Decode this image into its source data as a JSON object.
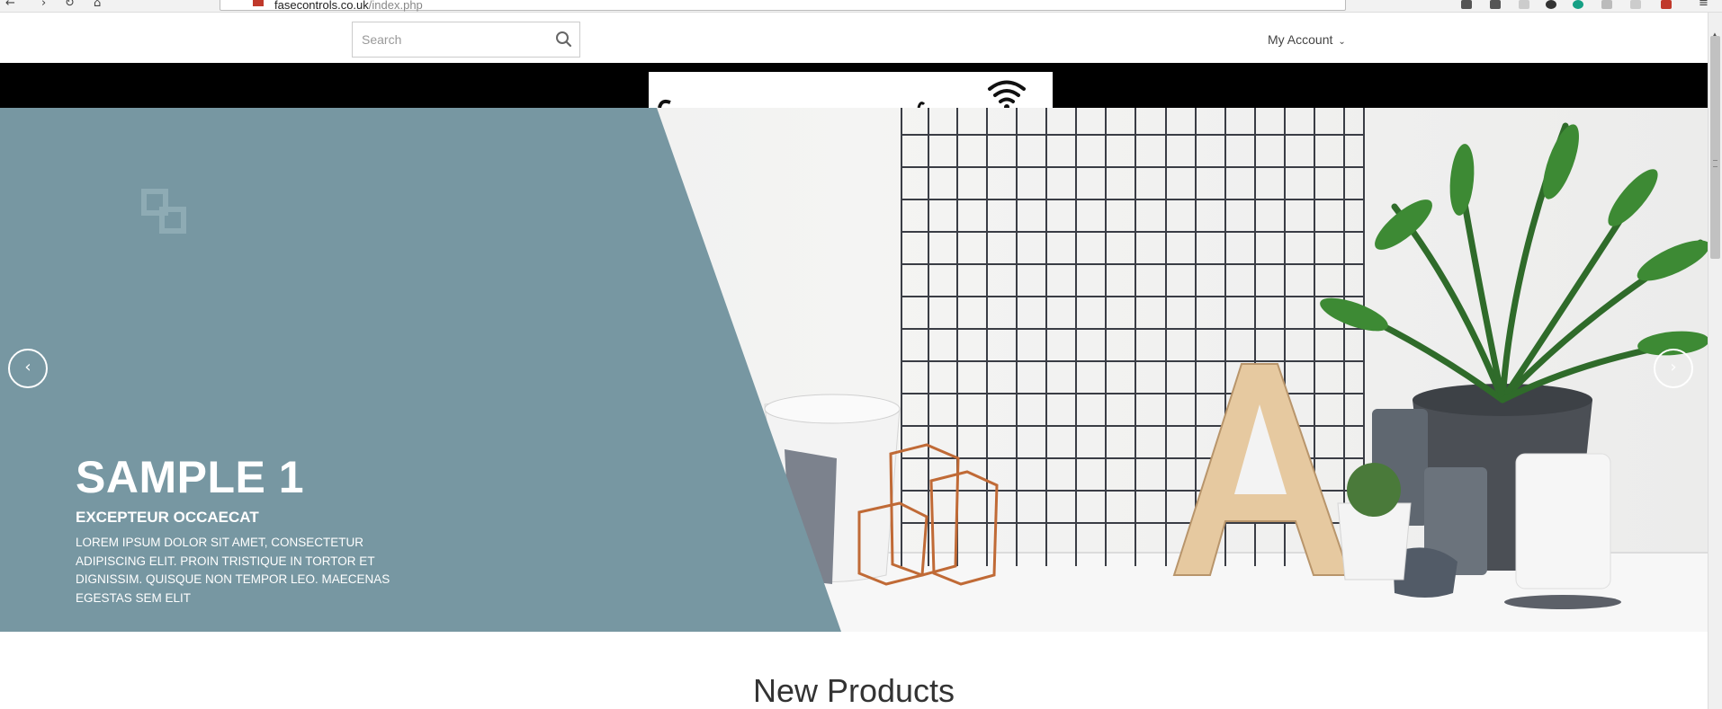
{
  "browser": {
    "url_host": "fasecontrols.co.uk",
    "url_path": "/index.php"
  },
  "header": {
    "search_placeholder": "Search",
    "account_label": "My Account"
  },
  "slide": {
    "title": "SAMPLE 1",
    "subtitle": "EXCEPTEUR OCCAECAT",
    "description": "LOREM IPSUM DOLOR SIT AMET, CONSECTETUR ADIPISCING ELIT. PROIN TRISTIQUE IN TORTOR ET DIGNISSIM. QUISQUE NON TEMPOR LEO. MAECENAS EGESTAS SEM ELIT",
    "prev_glyph": "‹",
    "next_glyph": "›"
  },
  "sections": {
    "new_products_title": "New Products"
  },
  "colors": {
    "panel": "#7797a2",
    "band": "#000000"
  },
  "icons": {
    "search": "search-icon",
    "wifi": "wifi-icon",
    "chevron": "chevron-down-icon"
  }
}
